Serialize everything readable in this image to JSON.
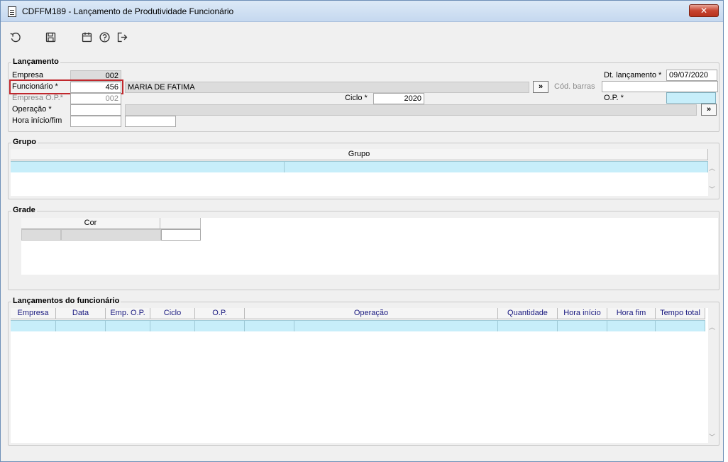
{
  "window": {
    "title": "CDFFM189 - Lançamento de Produtividade Funcionário",
    "close_label": "✕"
  },
  "toolbar": {
    "items": [
      {
        "name": "undo-icon"
      },
      {
        "name": "save-icon"
      },
      {
        "name": "calendar-icon"
      },
      {
        "name": "help-icon"
      },
      {
        "name": "exit-icon"
      }
    ]
  },
  "lancamento": {
    "legend": "Lançamento",
    "empresa_label": "Empresa",
    "empresa_value": "002",
    "funcionario_label": "Funcionário *",
    "funcionario_code": "456",
    "funcionario_name": "MARIA DE FATIMA",
    "more_label": "»",
    "cod_barras_label": "Cód. barras",
    "cod_barras_value": "",
    "dt_lancamento_label": "Dt. lançamento *",
    "dt_lancamento_value": "09/07/2020",
    "empresa_op_label": "Empresa O.P.*",
    "empresa_op_value": "002",
    "ciclo_label": "Ciclo *",
    "ciclo_value": "2020",
    "op_label": "O.P. *",
    "op_value": "",
    "operacao_label": "Operação *",
    "operacao_code": "",
    "operacao_desc": "",
    "hora_label": "Hora início/fim",
    "hora_inicio": "",
    "hora_fim": ""
  },
  "grupo": {
    "legend": "Grupo",
    "column": "Grupo"
  },
  "grade": {
    "legend": "Grade",
    "column": "Cor"
  },
  "lancamentos_func": {
    "legend": "Lançamentos do funcionário",
    "columns": [
      "Empresa",
      "Data",
      "Emp. O.P.",
      "Ciclo",
      "O.P.",
      "Operação",
      "Quantidade",
      "Hora início",
      "Hora fim",
      "Tempo total"
    ]
  },
  "colors": {
    "accent_cyan": "#c7eefa",
    "focus_red": "#c0282d"
  }
}
